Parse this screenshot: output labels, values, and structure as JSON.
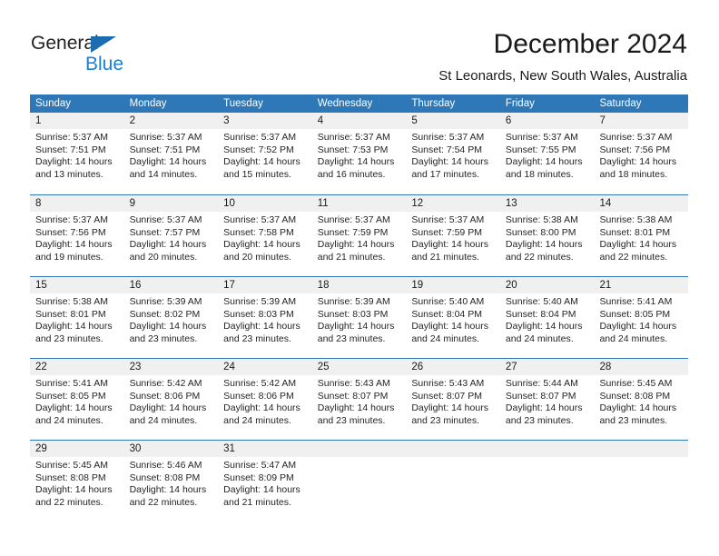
{
  "brand": {
    "name_part1": "General",
    "name_part2": "Blue",
    "accent_color": "#1b6cb0",
    "blue_text_color": "#1b7fd4"
  },
  "header": {
    "title": "December 2024",
    "subtitle": "St Leonards, New South Wales, Australia"
  },
  "theme": {
    "header_blue": "#2f78b8",
    "day_band_gray": "#f0f0f0",
    "text_color": "#242424"
  },
  "weekdays": [
    "Sunday",
    "Monday",
    "Tuesday",
    "Wednesday",
    "Thursday",
    "Friday",
    "Saturday"
  ],
  "weeks": [
    [
      {
        "day": "1",
        "sunrise": "Sunrise: 5:37 AM",
        "sunset": "Sunset: 7:51 PM",
        "daylight_l1": "Daylight: 14 hours",
        "daylight_l2": "and 13 minutes."
      },
      {
        "day": "2",
        "sunrise": "Sunrise: 5:37 AM",
        "sunset": "Sunset: 7:51 PM",
        "daylight_l1": "Daylight: 14 hours",
        "daylight_l2": "and 14 minutes."
      },
      {
        "day": "3",
        "sunrise": "Sunrise: 5:37 AM",
        "sunset": "Sunset: 7:52 PM",
        "daylight_l1": "Daylight: 14 hours",
        "daylight_l2": "and 15 minutes."
      },
      {
        "day": "4",
        "sunrise": "Sunrise: 5:37 AM",
        "sunset": "Sunset: 7:53 PM",
        "daylight_l1": "Daylight: 14 hours",
        "daylight_l2": "and 16 minutes."
      },
      {
        "day": "5",
        "sunrise": "Sunrise: 5:37 AM",
        "sunset": "Sunset: 7:54 PM",
        "daylight_l1": "Daylight: 14 hours",
        "daylight_l2": "and 17 minutes."
      },
      {
        "day": "6",
        "sunrise": "Sunrise: 5:37 AM",
        "sunset": "Sunset: 7:55 PM",
        "daylight_l1": "Daylight: 14 hours",
        "daylight_l2": "and 18 minutes."
      },
      {
        "day": "7",
        "sunrise": "Sunrise: 5:37 AM",
        "sunset": "Sunset: 7:56 PM",
        "daylight_l1": "Daylight: 14 hours",
        "daylight_l2": "and 18 minutes."
      }
    ],
    [
      {
        "day": "8",
        "sunrise": "Sunrise: 5:37 AM",
        "sunset": "Sunset: 7:56 PM",
        "daylight_l1": "Daylight: 14 hours",
        "daylight_l2": "and 19 minutes."
      },
      {
        "day": "9",
        "sunrise": "Sunrise: 5:37 AM",
        "sunset": "Sunset: 7:57 PM",
        "daylight_l1": "Daylight: 14 hours",
        "daylight_l2": "and 20 minutes."
      },
      {
        "day": "10",
        "sunrise": "Sunrise: 5:37 AM",
        "sunset": "Sunset: 7:58 PM",
        "daylight_l1": "Daylight: 14 hours",
        "daylight_l2": "and 20 minutes."
      },
      {
        "day": "11",
        "sunrise": "Sunrise: 5:37 AM",
        "sunset": "Sunset: 7:59 PM",
        "daylight_l1": "Daylight: 14 hours",
        "daylight_l2": "and 21 minutes."
      },
      {
        "day": "12",
        "sunrise": "Sunrise: 5:37 AM",
        "sunset": "Sunset: 7:59 PM",
        "daylight_l1": "Daylight: 14 hours",
        "daylight_l2": "and 21 minutes."
      },
      {
        "day": "13",
        "sunrise": "Sunrise: 5:38 AM",
        "sunset": "Sunset: 8:00 PM",
        "daylight_l1": "Daylight: 14 hours",
        "daylight_l2": "and 22 minutes."
      },
      {
        "day": "14",
        "sunrise": "Sunrise: 5:38 AM",
        "sunset": "Sunset: 8:01 PM",
        "daylight_l1": "Daylight: 14 hours",
        "daylight_l2": "and 22 minutes."
      }
    ],
    [
      {
        "day": "15",
        "sunrise": "Sunrise: 5:38 AM",
        "sunset": "Sunset: 8:01 PM",
        "daylight_l1": "Daylight: 14 hours",
        "daylight_l2": "and 23 minutes."
      },
      {
        "day": "16",
        "sunrise": "Sunrise: 5:39 AM",
        "sunset": "Sunset: 8:02 PM",
        "daylight_l1": "Daylight: 14 hours",
        "daylight_l2": "and 23 minutes."
      },
      {
        "day": "17",
        "sunrise": "Sunrise: 5:39 AM",
        "sunset": "Sunset: 8:03 PM",
        "daylight_l1": "Daylight: 14 hours",
        "daylight_l2": "and 23 minutes."
      },
      {
        "day": "18",
        "sunrise": "Sunrise: 5:39 AM",
        "sunset": "Sunset: 8:03 PM",
        "daylight_l1": "Daylight: 14 hours",
        "daylight_l2": "and 23 minutes."
      },
      {
        "day": "19",
        "sunrise": "Sunrise: 5:40 AM",
        "sunset": "Sunset: 8:04 PM",
        "daylight_l1": "Daylight: 14 hours",
        "daylight_l2": "and 24 minutes."
      },
      {
        "day": "20",
        "sunrise": "Sunrise: 5:40 AM",
        "sunset": "Sunset: 8:04 PM",
        "daylight_l1": "Daylight: 14 hours",
        "daylight_l2": "and 24 minutes."
      },
      {
        "day": "21",
        "sunrise": "Sunrise: 5:41 AM",
        "sunset": "Sunset: 8:05 PM",
        "daylight_l1": "Daylight: 14 hours",
        "daylight_l2": "and 24 minutes."
      }
    ],
    [
      {
        "day": "22",
        "sunrise": "Sunrise: 5:41 AM",
        "sunset": "Sunset: 8:05 PM",
        "daylight_l1": "Daylight: 14 hours",
        "daylight_l2": "and 24 minutes."
      },
      {
        "day": "23",
        "sunrise": "Sunrise: 5:42 AM",
        "sunset": "Sunset: 8:06 PM",
        "daylight_l1": "Daylight: 14 hours",
        "daylight_l2": "and 24 minutes."
      },
      {
        "day": "24",
        "sunrise": "Sunrise: 5:42 AM",
        "sunset": "Sunset: 8:06 PM",
        "daylight_l1": "Daylight: 14 hours",
        "daylight_l2": "and 24 minutes."
      },
      {
        "day": "25",
        "sunrise": "Sunrise: 5:43 AM",
        "sunset": "Sunset: 8:07 PM",
        "daylight_l1": "Daylight: 14 hours",
        "daylight_l2": "and 23 minutes."
      },
      {
        "day": "26",
        "sunrise": "Sunrise: 5:43 AM",
        "sunset": "Sunset: 8:07 PM",
        "daylight_l1": "Daylight: 14 hours",
        "daylight_l2": "and 23 minutes."
      },
      {
        "day": "27",
        "sunrise": "Sunrise: 5:44 AM",
        "sunset": "Sunset: 8:07 PM",
        "daylight_l1": "Daylight: 14 hours",
        "daylight_l2": "and 23 minutes."
      },
      {
        "day": "28",
        "sunrise": "Sunrise: 5:45 AM",
        "sunset": "Sunset: 8:08 PM",
        "daylight_l1": "Daylight: 14 hours",
        "daylight_l2": "and 23 minutes."
      }
    ],
    [
      {
        "day": "29",
        "sunrise": "Sunrise: 5:45 AM",
        "sunset": "Sunset: 8:08 PM",
        "daylight_l1": "Daylight: 14 hours",
        "daylight_l2": "and 22 minutes."
      },
      {
        "day": "30",
        "sunrise": "Sunrise: 5:46 AM",
        "sunset": "Sunset: 8:08 PM",
        "daylight_l1": "Daylight: 14 hours",
        "daylight_l2": "and 22 minutes."
      },
      {
        "day": "31",
        "sunrise": "Sunrise: 5:47 AM",
        "sunset": "Sunset: 8:09 PM",
        "daylight_l1": "Daylight: 14 hours",
        "daylight_l2": "and 21 minutes."
      },
      {
        "day": "",
        "sunrise": "",
        "sunset": "",
        "daylight_l1": "",
        "daylight_l2": ""
      },
      {
        "day": "",
        "sunrise": "",
        "sunset": "",
        "daylight_l1": "",
        "daylight_l2": ""
      },
      {
        "day": "",
        "sunrise": "",
        "sunset": "",
        "daylight_l1": "",
        "daylight_l2": ""
      },
      {
        "day": "",
        "sunrise": "",
        "sunset": "",
        "daylight_l1": "",
        "daylight_l2": ""
      }
    ]
  ]
}
